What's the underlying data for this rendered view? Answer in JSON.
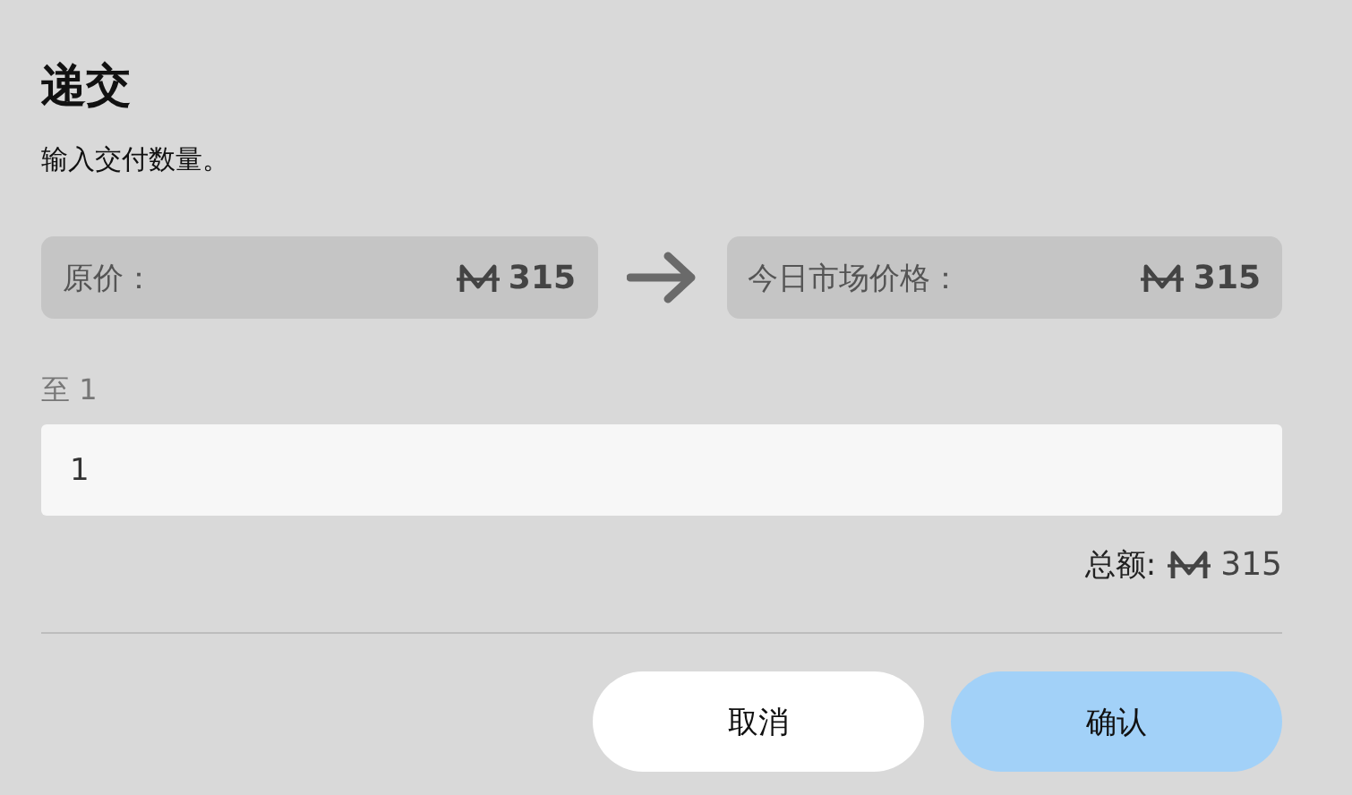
{
  "dialog": {
    "title": "递交",
    "subtitle": "输入交付数量。"
  },
  "prices": [
    {
      "label": "原价：",
      "amount": "315"
    },
    {
      "label": "今日市场价格：",
      "amount": "315"
    }
  ],
  "quantity": {
    "label": "至 1",
    "value": "1"
  },
  "total": {
    "label": "总额:",
    "amount": "315"
  },
  "buttons": [
    {
      "label": "取消",
      "kind": "secondary"
    },
    {
      "label": "确认",
      "kind": "primary"
    }
  ]
}
